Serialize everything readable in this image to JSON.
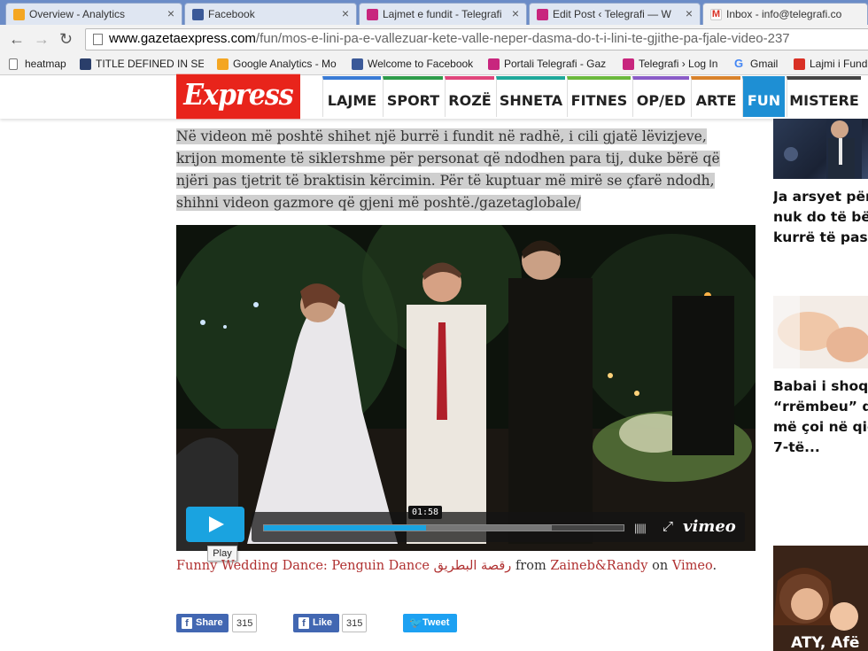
{
  "browser": {
    "tabs": [
      {
        "title": "Overview - Analytics",
        "icon": "analytics-icon",
        "color": "#f4a623"
      },
      {
        "title": "Facebook",
        "icon": "facebook-icon",
        "color": "#3b5998"
      },
      {
        "title": "Lajmet e fundit - Telegrafi",
        "icon": "telegrafi-icon",
        "color": "#c8267e"
      },
      {
        "title": "Edit Post ‹ Telegrafi — W",
        "icon": "telegrafi-icon",
        "color": "#c8267e"
      },
      {
        "title": "Inbox - info@telegrafi.co",
        "icon": "gmail-icon",
        "color": "#d93025"
      }
    ],
    "url_host": "www.gazetaexpress.com",
    "url_path": "/fun/mos-e-lini-pa-e-vallezuar-kete-valle-neper-dasma-do-t-i-lini-te-gjithe-pa-fjale-video-237",
    "bookmarks": [
      {
        "label": "heatmap",
        "icon": "page-icon",
        "color": "#ffffff"
      },
      {
        "label": "TITLE DEFINED IN SET",
        "icon": "bookmark-icon",
        "color": "#2a3e6a"
      },
      {
        "label": "Google Analytics - Mo",
        "icon": "analytics-icon",
        "color": "#f4a623"
      },
      {
        "label": "Welcome to Facebook",
        "icon": "facebook-icon",
        "color": "#3b5998"
      },
      {
        "label": "Portali Telegrafi - Gaz",
        "icon": "telegrafi-icon",
        "color": "#c8267e"
      },
      {
        "label": "Telegrafi › Log In",
        "icon": "telegrafi-icon",
        "color": "#c8267e"
      },
      {
        "label": "Gmail",
        "icon": "google-icon",
        "color": "#4285f4"
      },
      {
        "label": "Lajmi i Fund",
        "icon": "bookmark-icon",
        "color": "#d93025"
      }
    ]
  },
  "site": {
    "logo": "Express",
    "nav": [
      {
        "label": "LAJME",
        "color": "#3a7bd5"
      },
      {
        "label": "SPORT",
        "color": "#2e9b4a"
      },
      {
        "label": "ROZË",
        "color": "#e0457b"
      },
      {
        "label": "SHNETA",
        "color": "#1fa89a"
      },
      {
        "label": "FITNES",
        "color": "#6bb83d"
      },
      {
        "label": "OP/ED",
        "color": "#8a5cc7"
      },
      {
        "label": "ARTE",
        "color": "#d9822b"
      },
      {
        "label": "FUN",
        "color": "#1e8fd4"
      },
      {
        "label": "MISTERE",
        "color": "#444444"
      }
    ]
  },
  "article": {
    "intro": "Në videon më poshtë shihet një burrë i fundit në radhë, i cili gjatë lëvizjeve, krijon momente të siklетshme për personat që ndodhen para tij, duke bërë që njëri pas tjetrit të braktisin kërcimin. Për të kuptuar më mirë se çfarë ndodh, shihni videon gazmore që gjeni më poshtë./gazetaglobale/",
    "video": {
      "timecode": "01:58",
      "progress": 0.45,
      "loaded": 0.8,
      "tooltip": "Play",
      "brand": "vimeo"
    },
    "caption": {
      "title": "Funny Wedding Dance: Penguin Dance رقصة البطريق",
      "from": "from",
      "author": "Zaineb&Randy",
      "on": "on",
      "site": "Vimeo",
      "end": "."
    },
    "share": {
      "fb_share": "Share",
      "fb_share_count": "315",
      "fb_like": "Like",
      "fb_like_count": "315",
      "tweet": "Tweet"
    }
  },
  "sidebar": {
    "items": [
      {
        "lines": [
          "Ja arsyet përs",
          "nuk do të bëhi",
          "kurrë të pasu"
        ]
      },
      {
        "lines": [
          "Babai i shoqe",
          "“rrëmbeu” dh",
          "më çoi në qiel",
          "7-të..."
        ]
      },
      {
        "lines": [
          "ATY, Afë"
        ]
      }
    ]
  }
}
